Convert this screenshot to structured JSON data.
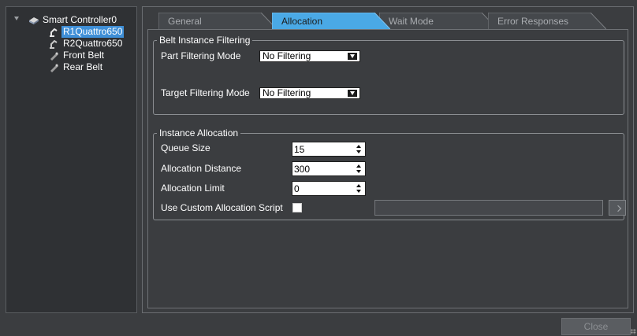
{
  "tree": {
    "items": [
      {
        "label": "Smart Controller0",
        "icon": "controller-icon"
      },
      {
        "label": "R1Quattro650",
        "icon": "robot-arm-icon",
        "selected": true
      },
      {
        "label": "R2Quattro650",
        "icon": "robot-arm-icon"
      },
      {
        "label": "Front Belt",
        "icon": "belt-icon"
      },
      {
        "label": "Rear Belt",
        "icon": "belt-icon"
      }
    ]
  },
  "tabs": [
    {
      "label": "General"
    },
    {
      "label": "Allocation",
      "active": true
    },
    {
      "label": "Wait Mode"
    },
    {
      "label": "Error Responses"
    }
  ],
  "belt_filtering": {
    "legend": "Belt Instance Filtering",
    "part_mode_label": "Part Filtering Mode",
    "part_mode_value": "No Filtering",
    "target_mode_label": "Target Filtering Mode",
    "target_mode_value": "No Filtering"
  },
  "instance_allocation": {
    "legend": "Instance Allocation",
    "queue_size_label": "Queue Size",
    "queue_size_value": "15",
    "allocation_distance_label": "Allocation Distance",
    "allocation_distance_value": "300",
    "allocation_limit_label": "Allocation Limit",
    "allocation_limit_value": "0",
    "custom_script_label": "Use Custom Allocation Script",
    "custom_script_checked": false,
    "custom_script_path": ""
  },
  "footer": {
    "close_label": "Close"
  },
  "colors": {
    "background": "#3b3d40",
    "selection": "#3f8fd7",
    "active_tab": "#4aa9e6"
  }
}
